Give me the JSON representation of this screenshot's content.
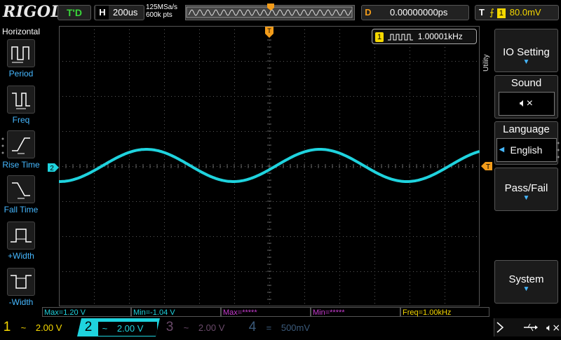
{
  "top": {
    "brand": "RIGOL",
    "run_state": "T'D",
    "horiz_label": "H",
    "timebase": "200us",
    "sample_rate": "125MSa/s",
    "mem_depth": "600k pts",
    "delay_label": "D",
    "delay_value": "0.00000000ps",
    "trig_label": "T",
    "trig_source": "1",
    "trig_level": "80.0mV"
  },
  "left": {
    "title": "Horizontal",
    "items": [
      {
        "label": "Period"
      },
      {
        "label": "Freq"
      },
      {
        "label": "Rise Time"
      },
      {
        "label": "Fall Time"
      },
      {
        "label": "+Width"
      },
      {
        "label": "-Width"
      }
    ]
  },
  "freq_counter": {
    "channel": "1",
    "value": "1.00001kHz"
  },
  "markers": {
    "ch2": "2",
    "trig_top": "T",
    "trig_right": "T"
  },
  "right_menu": {
    "utility": "Utility",
    "io_setting": "IO Setting",
    "sound": "Sound",
    "language_title": "Language",
    "language_value": "English",
    "passfail": "Pass/Fail",
    "system": "System"
  },
  "measurements": [
    {
      "text": "Max=1.20 V",
      "color": "#1fd3de"
    },
    {
      "text": "Min=-1.04 V",
      "color": "#1fd3de"
    },
    {
      "text": "Max=*****",
      "color": "#c83cd0"
    },
    {
      "text": "Min=*****",
      "color": "#c83cd0"
    },
    {
      "text": "Freq=1.00kHz",
      "color": "#f6d800"
    }
  ],
  "channels": [
    {
      "num": "1",
      "coupling": "~",
      "scale": "2.00 V",
      "color": "#f6d800"
    },
    {
      "num": "2",
      "coupling": "~",
      "scale": "2.00 V",
      "color": "#1fd3de"
    },
    {
      "num": "3",
      "coupling": "~",
      "scale": "2.00 V",
      "color": "#6a4a6a"
    },
    {
      "num": "4",
      "coupling": "=",
      "scale": "500mV",
      "color": "#3b5a7a"
    }
  ],
  "colors": {
    "ch2_trace": "#1fd3de",
    "trigger": "#f39c1a",
    "accent": "#46b8ff"
  }
}
